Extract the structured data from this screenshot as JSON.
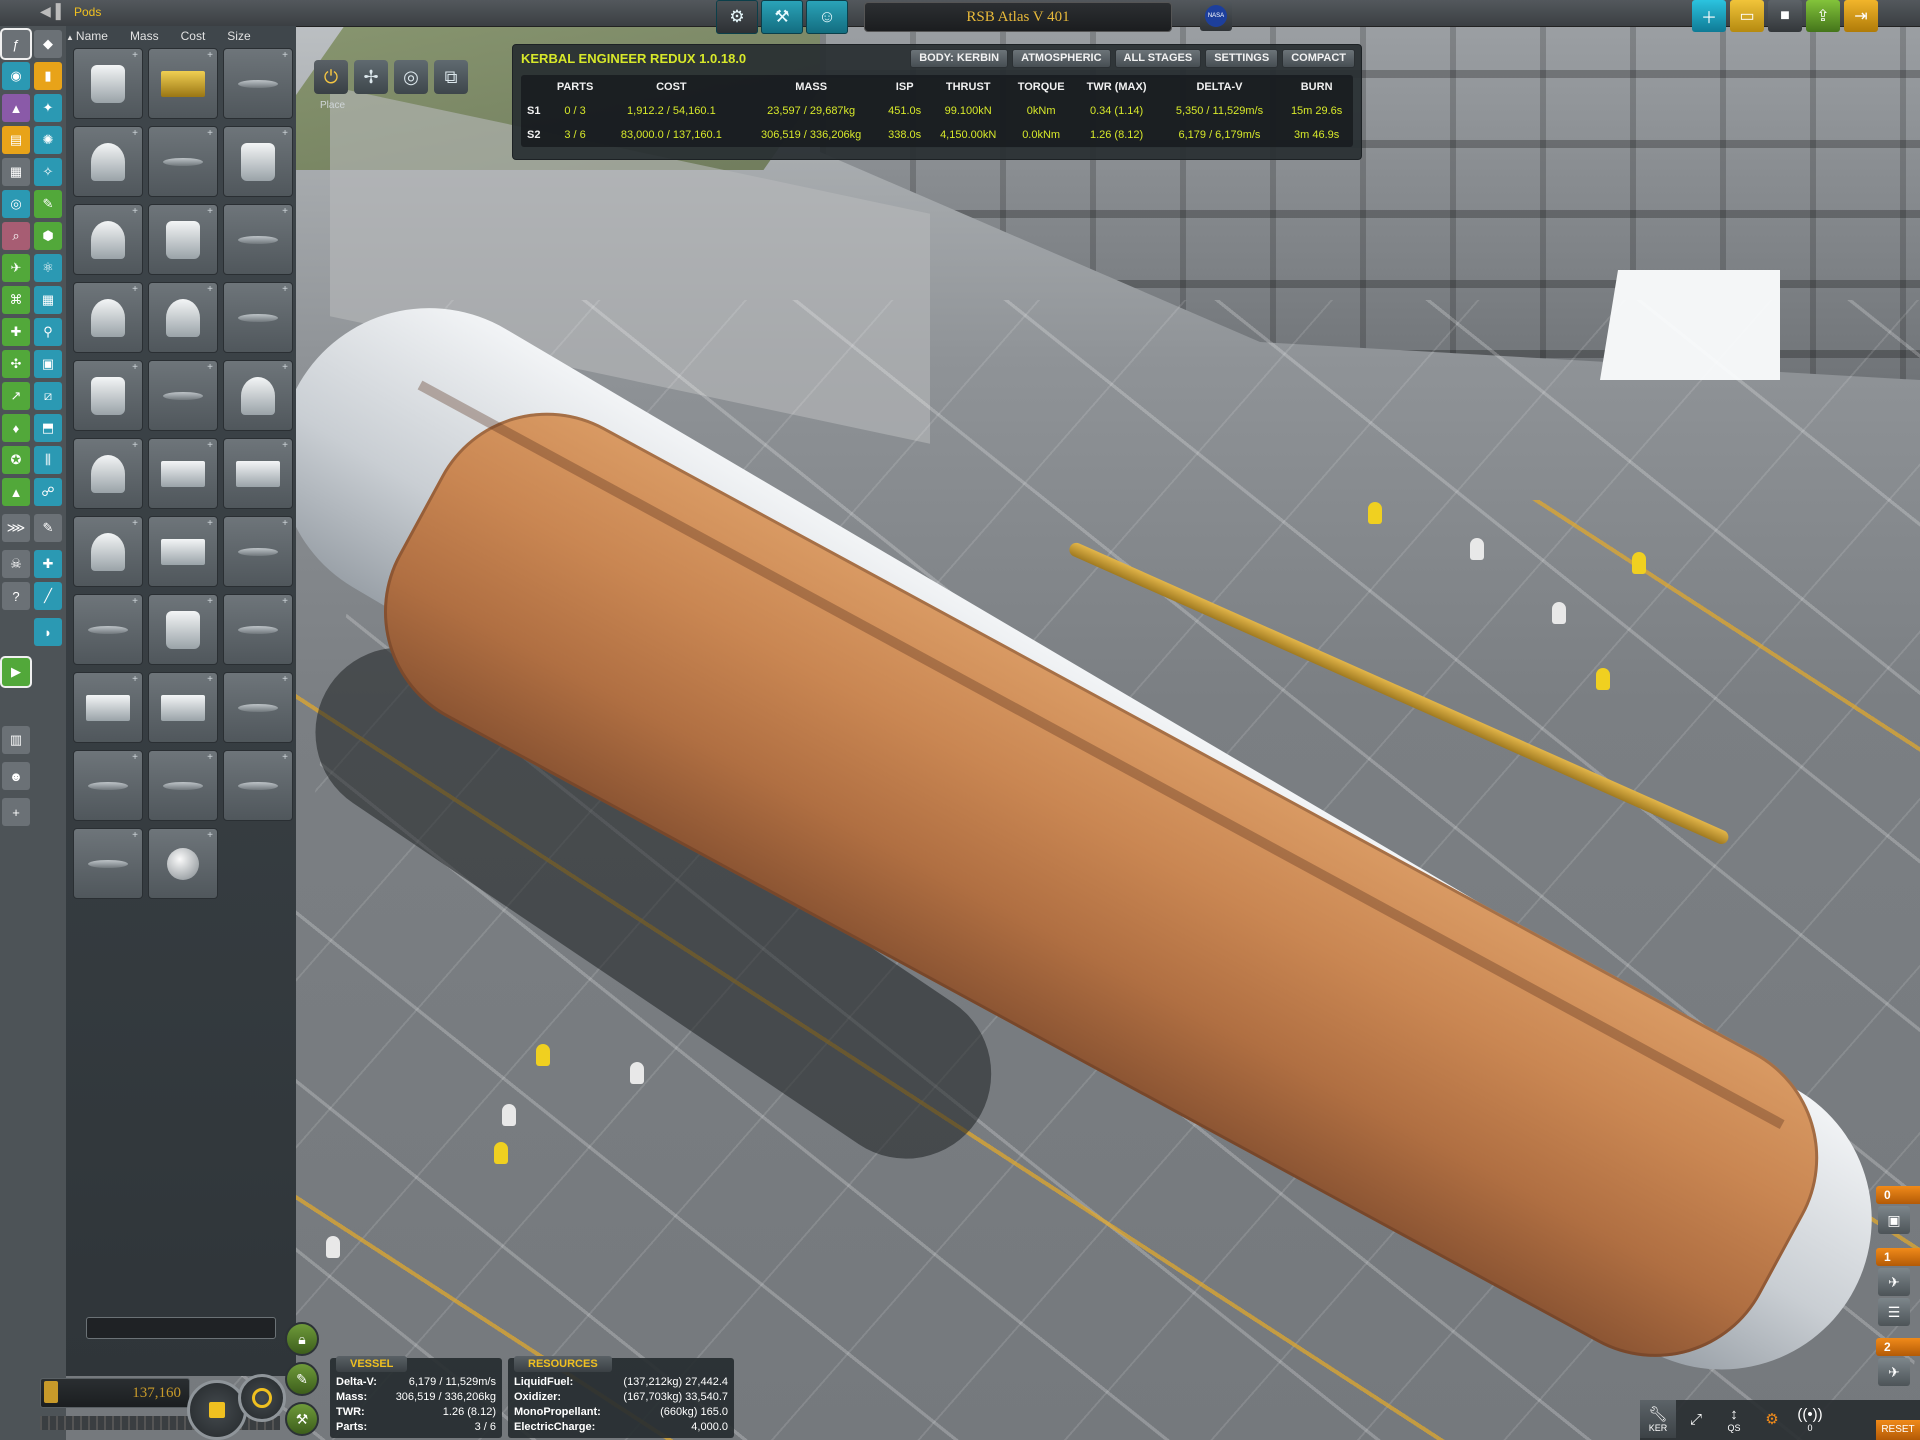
{
  "window": {
    "category_title": "Pods",
    "ship_name": "RSB Atlas V 401",
    "flag_text": "NASA"
  },
  "top_tools": {
    "center": [
      {
        "name": "action-groups-button",
        "icon": "gear-chip-icon",
        "glyph": "⚙"
      },
      {
        "name": "engineer-tools-button",
        "icon": "hammer-wrench-icon",
        "glyph": "⚒"
      },
      {
        "name": "crew-button",
        "icon": "kerbal-head-icon",
        "glyph": "☺"
      }
    ],
    "right": [
      {
        "name": "new-craft-button",
        "icon": "new-file-icon",
        "glyph": "＋"
      },
      {
        "name": "open-craft-button",
        "icon": "folder-icon",
        "glyph": "▭"
      },
      {
        "name": "save-craft-button",
        "icon": "save-disk-icon",
        "glyph": "■"
      },
      {
        "name": "launch-button",
        "icon": "launch-icon",
        "glyph": "⇪"
      },
      {
        "name": "exit-button",
        "icon": "exit-door-icon",
        "glyph": "⇥"
      }
    ]
  },
  "parts_panel": {
    "sort_columns": [
      "Name",
      "Mass",
      "Cost",
      "Size"
    ],
    "search_value": "",
    "craft_cost": "137,160"
  },
  "editor_modes": {
    "label": "Place",
    "modes": [
      {
        "name": "place-mode-button",
        "icon": "place-icon",
        "glyph": "⏻"
      },
      {
        "name": "offset-mode-button",
        "icon": "offset-icon",
        "glyph": "✢"
      },
      {
        "name": "rotate-mode-button",
        "icon": "rotate-icon",
        "glyph": "◎"
      },
      {
        "name": "root-mode-button",
        "icon": "root-icon",
        "glyph": "⧉"
      }
    ]
  },
  "ker": {
    "title": "KERBAL ENGINEER REDUX 1.0.18.0",
    "buttons": [
      "BODY: KERBIN",
      "ATMOSPHERIC",
      "ALL STAGES",
      "SETTINGS",
      "COMPACT"
    ],
    "headers": [
      "",
      "PARTS",
      "COST",
      "MASS",
      "ISP",
      "THRUST",
      "TORQUE",
      "TWR (MAX)",
      "DELTA-V",
      "BURN"
    ],
    "rows": [
      [
        "S1",
        "0 / 3",
        "1,912.2 / 54,160.1",
        "23,597 / 29,687kg",
        "451.0s",
        "99.100kN",
        "0kNm",
        "0.34 (1.14)",
        "5,350 / 11,529m/s",
        "15m 29.6s"
      ],
      [
        "S2",
        "3 / 6",
        "83,000.0 / 137,160.1",
        "306,519 / 336,206kg",
        "338.0s",
        "4,150.00kN",
        "0.0kNm",
        "1.26 (8.12)",
        "6,179 / 6,179m/s",
        "3m 46.9s"
      ]
    ]
  },
  "vessel": {
    "title": "VESSEL",
    "rows": [
      {
        "k": "Delta-V:",
        "v": "6,179 / 11,529m/s"
      },
      {
        "k": "Mass:",
        "v": "306,519 / 336,206kg"
      },
      {
        "k": "TWR:",
        "v": "1.26 (8.12)"
      },
      {
        "k": "Parts:",
        "v": "3 / 6"
      }
    ]
  },
  "resources": {
    "title": "RESOURCES",
    "rows": [
      {
        "k": "LiquidFuel:",
        "v": "(137,212kg) 27,442.4"
      },
      {
        "k": "Oxidizer:",
        "v": "(167,703kg) 33,540.7"
      },
      {
        "k": "MonoPropellant:",
        "v": "(660kg) 165.0"
      },
      {
        "k": "ElectricCharge:",
        "v": "4,000.0"
      }
    ]
  },
  "staging": [
    {
      "num": "0"
    },
    {
      "num": "1"
    },
    {
      "num": "2"
    }
  ],
  "appbar": {
    "ker_label": "KER",
    "qs_label": "QS",
    "antenna_count": "0",
    "reset_label": "RESET"
  }
}
